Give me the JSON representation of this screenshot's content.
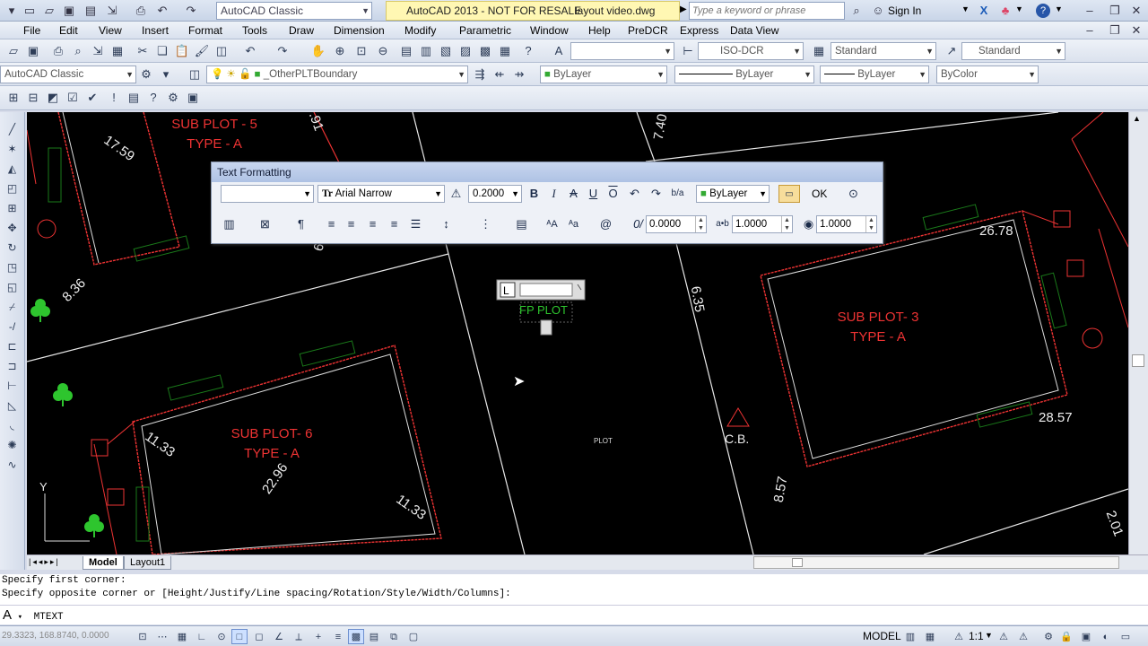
{
  "titlebar": {
    "workspace": "AutoCAD Classic",
    "title": "AutoCAD 2013 - NOT FOR RESALE",
    "filename": "layout video.dwg",
    "search_placeholder": "Type a keyword or phrase",
    "sign_in": "Sign In"
  },
  "menus": [
    "File",
    "Edit",
    "View",
    "Insert",
    "Format",
    "Tools",
    "Draw",
    "Dimension",
    "Modify",
    "Parametric",
    "Window",
    "Help",
    "PreDCR",
    "Express",
    "Data View"
  ],
  "toolbar2": {
    "text_style": "ISO-DCR",
    "dim_style": "Standard",
    "table_style": "Standard"
  },
  "toolbar3": {
    "workspace": "AutoCAD Classic",
    "layer": "_OtherPLTBoundary",
    "color": "ByLayer",
    "linetype": "ByLayer",
    "lineweight": "ByLayer",
    "plotstyle": "ByColor"
  },
  "text_formatting": {
    "title": "Text Formatting",
    "style": "",
    "font": "Arial Narrow",
    "height": "0.2000",
    "color": "ByLayer",
    "ok": "OK",
    "oblique": "0.0000",
    "tracking": "1.0000",
    "width_factor": "1.0000"
  },
  "drawing": {
    "labels": {
      "sp5": "SUB PLOT - 5",
      "sp5_type": "TYPE - A",
      "sp3": "SUB PLOT- 3",
      "sp3_type": "TYPE - A",
      "sp6": "SUB PLOT- 6",
      "sp6_type": "TYPE - A",
      "mtext": "FP PLOT",
      "plot_small": "PLOT",
      "cb": "C.B.",
      "ucs_y": "Y"
    },
    "dims": {
      "d1": "17.59",
      "d2": "8.36",
      "d3": "7.40",
      "d4": ".91",
      "d5": "6.35",
      "d6": "26.78",
      "d7": "28.57",
      "d8": "8.57",
      "d9": "22.96",
      "d10": "11.33",
      "d11": "11.33",
      "d12": "2.01",
      "d13": "6."
    }
  },
  "tabs": [
    "Model",
    "Layout1"
  ],
  "command": {
    "history1": "Specify first corner:",
    "history2": "Specify opposite corner or [Height/Justify/Line spacing/Rotation/Style/Width/Columns]:",
    "current": "MTEXT"
  },
  "status": {
    "coords": "29.3323, 168.8740, 0.0000",
    "model": "MODEL",
    "scale": "1:1"
  }
}
